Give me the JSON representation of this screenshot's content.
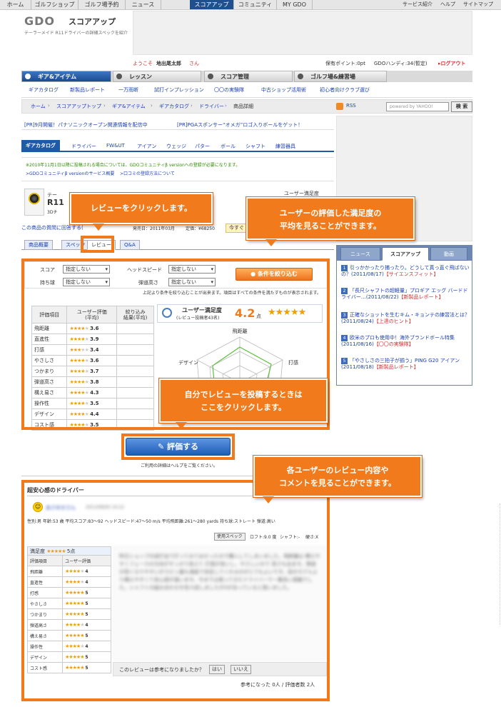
{
  "top_nav": {
    "items": [
      "ホーム",
      "ゴルフショップ",
      "ゴルフ場予約",
      "ニュース",
      "スコアアップ",
      "コミュニティ",
      "MY GDO"
    ],
    "active": "スコアアップ",
    "right_items": [
      "サービス紹介",
      "ヘルプ",
      "サイトマップ"
    ]
  },
  "header": {
    "logo": "GDO",
    "site_name": "スコアアップ",
    "tagline": "テーラーメイド R11ドライバーの詳細スペックを紹介",
    "welcome_prefix": "ようこそ",
    "user_name": "地出尾太郎",
    "welcome_suffix": "さん",
    "points": "保有ポイント:0pt",
    "handicap": "GDOハンディ:34(暫定)",
    "logout": "ログアウト"
  },
  "main_tabs": [
    "ギア&アイテム",
    "レッスン",
    "スコア管理",
    "ゴルフ場&練習場"
  ],
  "sub_nav": [
    "ギアカタログ",
    "新製品レポート",
    "一万雨断",
    "試打インプレッション",
    "〇〇の実験隊",
    "中古ショップ活用術",
    "初心者向けクラブ選び"
  ],
  "breadcrumb": [
    "ホーム",
    "スコアアップトップ",
    "ギア&アイテム",
    "ギアカタログ",
    "ドライバー",
    "商品詳細"
  ],
  "rss": "RSS",
  "search": {
    "placeholder": "powered by YAHOO!",
    "button": "検 索"
  },
  "pr_links": [
    "[PR]9月開催！パナソニックオープン関連情報を配信中",
    "[PR]PGAスポンサー“オメガ”ロゴ入りボールをゲット！"
  ],
  "cat_tabs": [
    "ギアカタログ",
    "ドライバー",
    "FW&UT",
    "アイアン",
    "ウェッジ",
    "パター",
    "ボール",
    "シャフト",
    "練習器具"
  ],
  "notice": {
    "line1": "※2010年11月1日以降に投稿される場合については、GDOコミュニティβ versionへの登録が必要になります。",
    "link1": ">GDOコミュニティβ versionのサービス概要",
    "link2": ">口コミの登録方法について"
  },
  "product": {
    "brand": "テー",
    "name": "R11",
    "sub": "3Dチ",
    "satisfaction_label": "ユーザー満足度",
    "question_link": "この商品の質問に回答する(",
    "release": "発売日：2011年03月",
    "price": "定価：¥68250",
    "buy_button": "今すぐ"
  },
  "review_tabs": [
    "商品概要",
    "スペック",
    "レビュー",
    "Q&A"
  ],
  "filters": {
    "score_label": "スコア",
    "score_value": "指定しない",
    "headspeed_label": "ヘッドスピード",
    "headspeed_value": "指定しない",
    "ballflight_label": "持ち球",
    "ballflight_value": "指定しない",
    "trajectory_label": "弾道高さ",
    "trajectory_value": "指定しない",
    "button": "条件を絞り込む",
    "note": "上記より条件を絞り込むことが出来ます。項目はすべての条件を満たすものが表示されます。"
  },
  "eval_table": {
    "headers": [
      "評価項目",
      "ユーザー評価\n(平均)",
      "絞り込み\n結果(平均)"
    ],
    "rows": [
      {
        "item": "飛距離",
        "score": "3.6",
        "stars": 4
      },
      {
        "item": "直進性",
        "score": "3.9",
        "stars": 4
      },
      {
        "item": "打感",
        "score": "3.4",
        "stars": 3
      },
      {
        "item": "やさしさ",
        "score": "3.6",
        "stars": 4
      },
      {
        "item": "つかまり",
        "score": "3.7",
        "stars": 4
      },
      {
        "item": "弾道高さ",
        "score": "3.8",
        "stars": 4
      },
      {
        "item": "構え易さ",
        "score": "4.3",
        "stars": 4
      },
      {
        "item": "操作性",
        "score": "3.5",
        "stars": 4
      },
      {
        "item": "デザイン",
        "score": "4.4",
        "stars": 4
      },
      {
        "item": "コスト感",
        "score": "3.5",
        "stars": 4
      }
    ]
  },
  "satisfaction": {
    "label": "ユーザー満足度",
    "sub": "(レビュー投稿者43名)",
    "score": "4.2",
    "unit": "点",
    "stars": 4
  },
  "radar": {
    "labels": [
      "飛距離",
      "打感",
      "デザイン"
    ]
  },
  "rate_button": "評価する",
  "rate_note": "ご利用の詳細はヘルプをご覧ください。",
  "right_tabs": [
    "ニュース",
    "スコアアップ",
    "動画"
  ],
  "right_list": [
    {
      "n": "1",
      "text": "引っかかったり捕ったり。どうして真っ直ぐ飛ばないの？(2011/08/17)",
      "tag": "【サイエンスフィット】"
    },
    {
      "n": "2",
      "text": "「長尺シャフトの超軽量」プロギア エッグ バードドライバー…(2011/08/22)",
      "tag": "【新製品レポート】"
    },
    {
      "n": "3",
      "text": "正確なショットを生むキム・キョンテの練習法とは？(2011/08/24)",
      "tag": "【上達のヒント】"
    },
    {
      "n": "4",
      "text": "欧米のプロも使用中！海外ブランドボール特集(2011/08/16)",
      "tag": "【〇〇の実験隊】"
    },
    {
      "n": "5",
      "text": "「やさしさの三拍子が揃う」PING G20 アイアン(2011/08/18)",
      "tag": "【新製品レポート】"
    }
  ],
  "review": {
    "title": "超安心感のドライバー",
    "user": "あさゆきさん",
    "date": "2011/09/05 14:12",
    "profile": "性別:男 年齢:53 歳  平均スコア:83〜92  ヘッドスピード:47〜50 m/s  平均飛距離:261〜280 yards  持ち球:ストレート  弾道:高い",
    "spec_btn": "使用スペック",
    "loft": "ロフト:9.0 度",
    "shaft": "シャフト:-",
    "hardness": "硬さ:X",
    "sat_label": "満足度",
    "sat_score": "5点",
    "table_header": [
      "評価項目",
      "ユーザー評価"
    ],
    "rows": [
      {
        "item": "飛距離",
        "v": "4",
        "stars": 4
      },
      {
        "item": "直進性",
        "v": "4",
        "stars": 4
      },
      {
        "item": "打感",
        "v": "5",
        "stars": 5
      },
      {
        "item": "やさしさ",
        "v": "5",
        "stars": 5
      },
      {
        "item": "つかまり",
        "v": "5",
        "stars": 5
      },
      {
        "item": "弾道高さ",
        "v": "4",
        "stars": 4
      },
      {
        "item": "構え易さ",
        "v": "5",
        "stars": 5
      },
      {
        "item": "操作性",
        "v": "4",
        "stars": 4
      },
      {
        "item": "デザイン",
        "v": "5",
        "stars": 5
      },
      {
        "item": "コスト感",
        "v": "5",
        "stars": 5
      }
    ],
    "body": "昨日ショップの試打会で打ってみておかったので購入してしまいました。飛距離は 構えやすくフェースの方向がすっきり見えて 打感が良いし、やさしいので 高さも出ます。弾道が高くなりやすいがスピン量も適度で安定してくれるのがとてもよいです。前のモデルより構えやすくて安心感が違います。今までは使ってきたドライバーで一番良い感触でした。シャフトの組み合わせを色々試しましたがXが合っていると思いました。",
    "helpful_q": "このレビューは参考になりましたか？",
    "yes": "はい",
    "no": "いいえ",
    "vote_info": "参考になった 0人 / 評価者数 2人"
  },
  "callouts": {
    "c1": "レビューをクリックします。",
    "c2": "ユーザーの評価した満足度の\n平均を見ることができます。",
    "c3": "自分でレビューを投稿するときは\nここをクリックします。",
    "c4": "各ユーザーのレビュー内容や\nコメントを見ることができます。"
  }
}
